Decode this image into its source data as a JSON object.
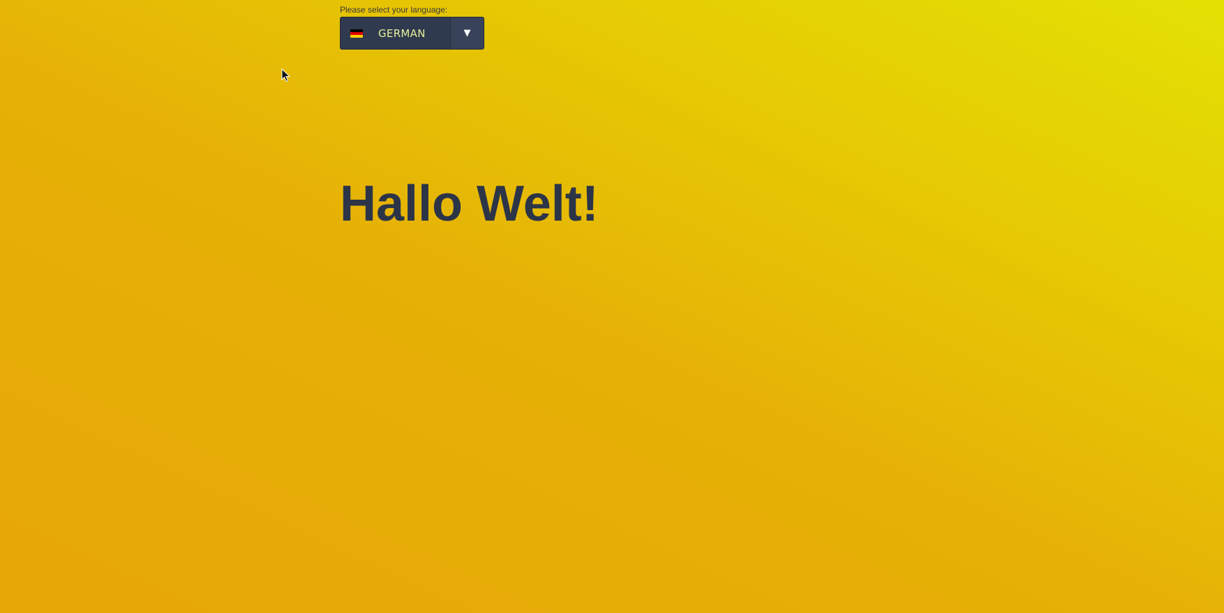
{
  "language_picker": {
    "label": "Please select your language:",
    "selected_value": "GERMAN",
    "flag_icon": "germany-flag-icon",
    "arrow_icon": "triangle-down-icon",
    "arrow_glyph": "▼"
  },
  "main": {
    "heading": "Hallo Welt!"
  },
  "colors": {
    "background_top_right": "#e3e104",
    "background_bottom_left": "#e7a707",
    "select_background": "#2f3a4f",
    "select_text": "#e6ef9a",
    "heading_text": "#2c3547",
    "flag_black": "#000000",
    "flag_red": "#dd0000",
    "flag_gold": "#ffce00"
  }
}
